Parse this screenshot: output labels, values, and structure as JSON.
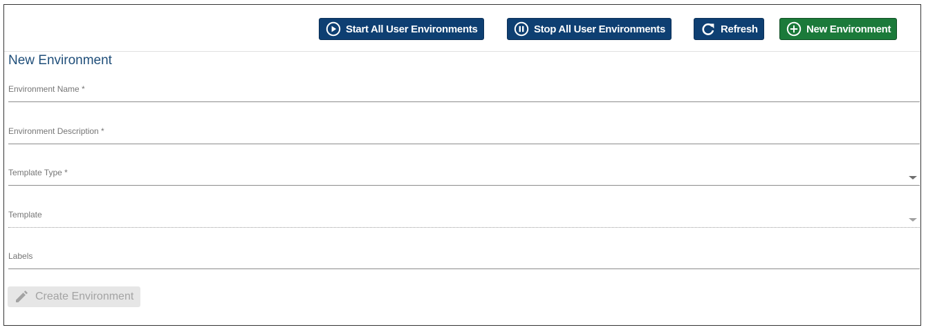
{
  "toolbar": {
    "start_all_label": "Start All User Environments",
    "stop_all_label": "Stop All User Environments",
    "refresh_label": "Refresh",
    "new_environment_label": "New Environment"
  },
  "form": {
    "title": "New Environment",
    "fields": [
      {
        "label": "Environment Name *",
        "value": ""
      },
      {
        "label": "Environment Description *",
        "value": ""
      },
      {
        "label": "Template Type *",
        "value": ""
      },
      {
        "label": "Template",
        "value": ""
      },
      {
        "label": "Labels",
        "value": ""
      }
    ],
    "create_label": "Create Environment"
  },
  "icons": {
    "start_all": "play-circle-icon",
    "stop_all": "pause-circle-icon",
    "refresh": "refresh-icon",
    "new_environment": "plus-circle-icon",
    "create": "pencil-icon"
  },
  "colors": {
    "primary_button": "#0e3f72",
    "success_button": "#1b7a3a",
    "title_text": "#1f4e79",
    "disabled_button_bg": "#e6e6e6",
    "disabled_button_text": "#a3a3a3"
  }
}
